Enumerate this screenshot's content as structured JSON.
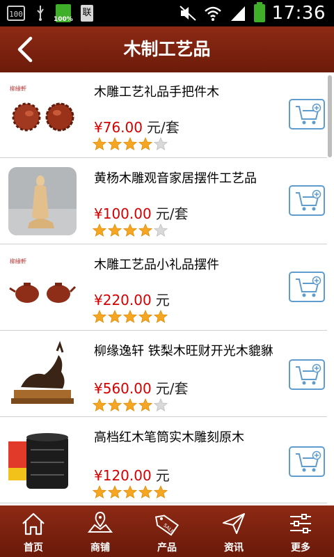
{
  "status_bar": {
    "left_badge": "100",
    "battery_small_label": "100%",
    "doc_glyph": "联",
    "time": "17:36"
  },
  "header": {
    "title": "木制工艺品"
  },
  "products": [
    {
      "name": "木雕工艺礼品手把件木",
      "price": "¥76.00",
      "unit": "元/套",
      "rating": 4
    },
    {
      "name": "黄杨木雕观音家居摆件工艺品",
      "price": "¥100.00",
      "unit": "元/套",
      "rating": 4
    },
    {
      "name": "木雕工艺品小礼品摆件",
      "price": "¥220.00",
      "unit": "元",
      "rating": 5
    },
    {
      "name": "柳缘逸轩 铁梨木旺财开光木貔貅",
      "price": "¥560.00",
      "unit": "元/套",
      "rating": 4
    },
    {
      "name": " 高档红木笔筒实木雕刻原木",
      "price": "¥120.00",
      "unit": "元",
      "rating": 5
    }
  ],
  "thumb_logo_text": "柳緣軒",
  "bottom_nav": [
    {
      "label": "首页",
      "icon": "home-icon"
    },
    {
      "label": "商铺",
      "icon": "map-icon"
    },
    {
      "label": "产品",
      "icon": "sale-tag-icon"
    },
    {
      "label": "资讯",
      "icon": "paper-plane-icon"
    },
    {
      "label": "更多",
      "icon": "sliders-icon"
    }
  ],
  "colors": {
    "header": "#7a2110",
    "price": "#d40000",
    "star": "#f5a623",
    "cart_border": "#5e9ccd"
  }
}
